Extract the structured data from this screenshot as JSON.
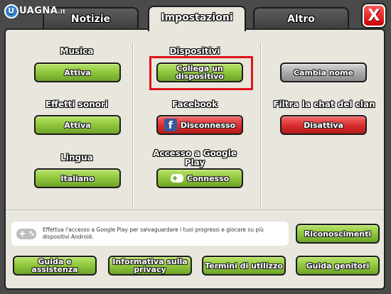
{
  "watermark": {
    "text": "UAGNA",
    "suffix": ".it"
  },
  "tabs": [
    {
      "label": "Notizie"
    },
    {
      "label": "Impostazioni"
    },
    {
      "label": "Altro"
    }
  ],
  "close_label": "X",
  "settings": {
    "music": {
      "label": "Musica",
      "button": "Attiva"
    },
    "sound_effects": {
      "label": "Effetti sonori",
      "button": "Attiva"
    },
    "language": {
      "label": "Lingua",
      "button": "Italiano"
    },
    "devices": {
      "label": "Dispositivi",
      "button_line1": "Collega un",
      "button_line2": "dispositivo"
    },
    "facebook": {
      "label": "Facebook",
      "button": "Disconnesso"
    },
    "google_play": {
      "label_line1": "Accesso a Google",
      "label_line2": "Play",
      "button": "Connesso"
    },
    "change_name": {
      "button": "Cambia nome"
    },
    "clan_chat_filter": {
      "label": "Filtra la chat del clan",
      "button": "Disattiva"
    }
  },
  "info": {
    "text_line1": "Effettua l'accesso a Google Play per salvaguardare i tuoi progressi e giocare su più",
    "text_line2": "dispositivi Android."
  },
  "bottom_buttons": {
    "credits": "Riconoscimenti",
    "help": "Guida e assistenza",
    "privacy_line1": "Informativa sulla",
    "privacy_line2": "privacy",
    "terms": "Termini di utilizzo",
    "parents": "Guida genitori"
  },
  "colors": {
    "green": "#8fc63b",
    "red": "#d92c2c",
    "gray": "#a8a8a8",
    "panel": "#e8e6dd",
    "highlight": "#e0141a"
  }
}
